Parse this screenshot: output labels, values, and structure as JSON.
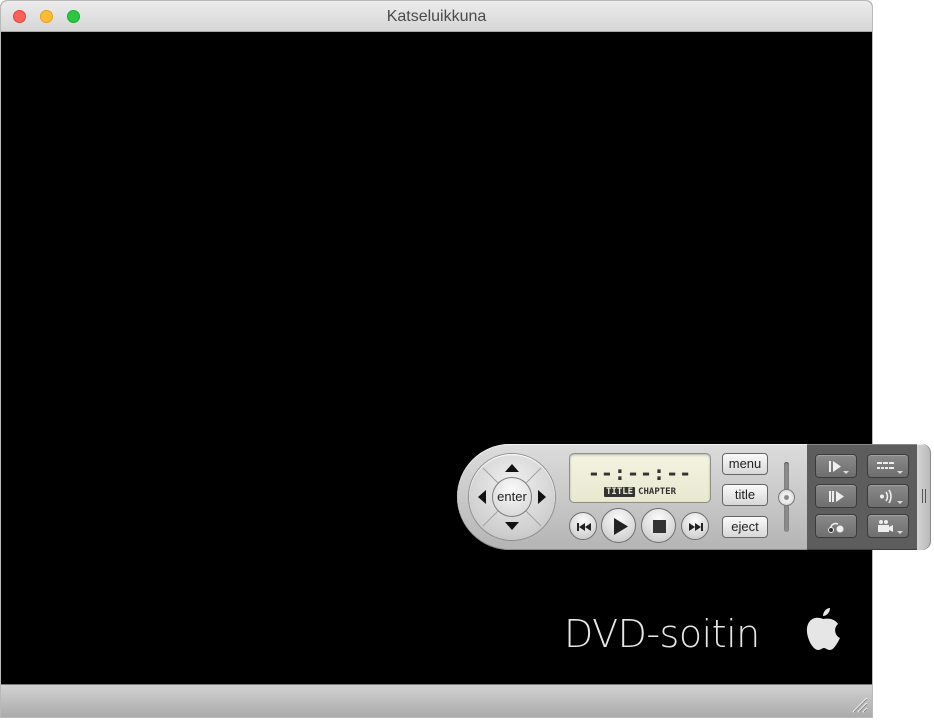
{
  "window": {
    "title": "Katseluikkuna",
    "buttons": [
      "close",
      "minimize",
      "zoom"
    ]
  },
  "viewer": {
    "brand_text": "DVD-soitin",
    "logo": "apple-logo-icon"
  },
  "controller": {
    "dpad": {
      "enter_label": "enter",
      "arrows": [
        "up-arrow-icon",
        "down-arrow-icon",
        "left-arrow-icon",
        "right-arrow-icon"
      ]
    },
    "display": {
      "time": "--:--:--",
      "label_title": "TITLE",
      "label_chapter": "CHAPTER",
      "active_label": "TITLE"
    },
    "transport": [
      "previous-chapter-icon",
      "play-icon",
      "stop-icon",
      "next-chapter-icon"
    ],
    "side_buttons": {
      "menu": "menu",
      "title": "title",
      "eject": "eject"
    },
    "volume": {
      "level": 0.5
    },
    "extended_panel": {
      "buttons": [
        {
          "icon": "slow-motion-icon",
          "dropdown": true
        },
        {
          "icon": "subtitles-icon",
          "dropdown": true
        },
        {
          "icon": "step-frame-icon",
          "dropdown": false
        },
        {
          "icon": "audio-track-icon",
          "dropdown": true
        },
        {
          "icon": "return-icon",
          "dropdown": false
        },
        {
          "icon": "camera-angle-icon",
          "dropdown": true
        }
      ]
    }
  }
}
